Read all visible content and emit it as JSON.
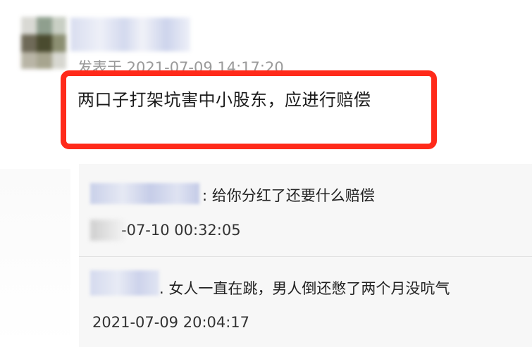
{
  "post": {
    "timestamp": "发表于 2021-07-09 14:17:20",
    "content": "两口子打架坑害中小股东，应进行赔偿"
  },
  "replies": [
    {
      "text": ": 给你分红了还要什么赔偿",
      "time_visible": "-07-10 00:32:05"
    },
    {
      "text": ". 女人一直在跳，男人倒还憋了两个月没吭气",
      "time_visible": "2021-07-09 20:04:17"
    }
  ],
  "colors": {
    "highlight": "#ff2a1a",
    "reply_bg": "#f7f7f7",
    "timestamp": "#9a9a9a"
  }
}
